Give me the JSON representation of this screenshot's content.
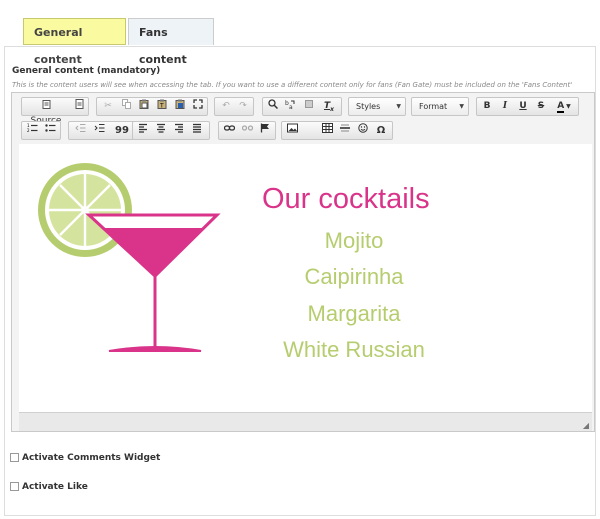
{
  "tabs": [
    {
      "label": "General content",
      "active": true
    },
    {
      "label": "Fans content",
      "active": false
    }
  ],
  "field": {
    "label": "General content (mandatory)",
    "hint": "This is the content users will see when accessing the tab. If you want to use a different content only for fans (Fan Gate) must be included on the 'Fans Content'"
  },
  "toolbar": {
    "source_label": "Source",
    "styles_label": "Styles",
    "format_label": "Format",
    "bold_label": "B",
    "italic_label": "I",
    "underline_label": "U",
    "strike_label": "S",
    "font_color_label": "A",
    "blockquote_label": "99",
    "omega_label": "Ω"
  },
  "content": {
    "title": "Our cocktails",
    "drinks": [
      "Mojito",
      "Caipirinha",
      "Margarita",
      "White Russian"
    ]
  },
  "options": {
    "comments_label": "Activate Comments Widget",
    "like_label": "Activate Like"
  },
  "colors": {
    "title_pink": "#d9348a",
    "drink_green": "#b6cd6f",
    "active_tab": "#fafaa0"
  }
}
